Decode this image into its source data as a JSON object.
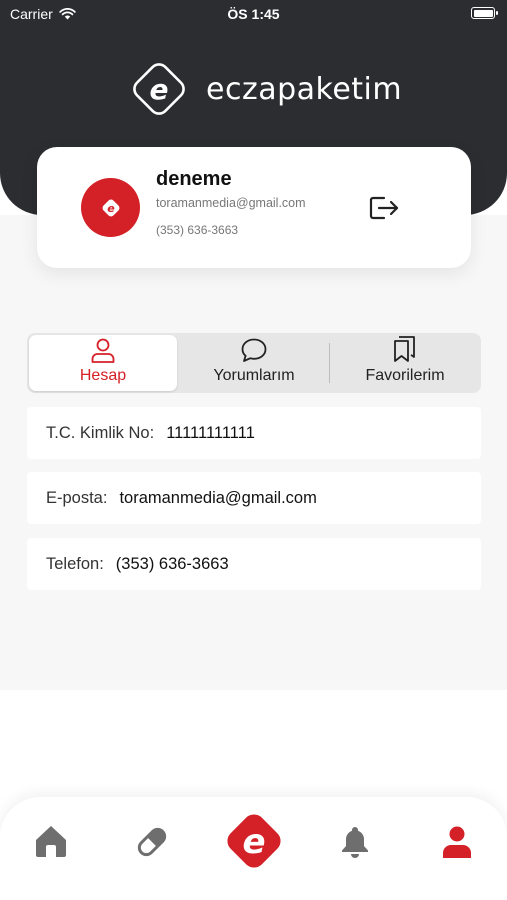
{
  "status_bar": {
    "carrier": "Carrier",
    "time": "ÖS 1:45"
  },
  "brand": {
    "name": "eczapaketim"
  },
  "profile": {
    "name": "deneme",
    "email": "toramanmedia@gmail.com",
    "phone": "(353) 636-3663"
  },
  "tabs": [
    {
      "label": "Hesap",
      "icon": "person-icon",
      "active": true
    },
    {
      "label": "Yorumlarım",
      "icon": "chat-bubble-icon",
      "active": false
    },
    {
      "label": "Favorilerim",
      "icon": "bookmarks-icon",
      "active": false
    }
  ],
  "fields": {
    "tc": {
      "label": "T.C. Kimlik No:",
      "value": "11111111111"
    },
    "email": {
      "label": "E-posta:",
      "value": "toramanmedia@gmail.com"
    },
    "phone": {
      "label": "Telefon:",
      "value": "(353) 636-3663"
    }
  },
  "bottom_nav": [
    {
      "icon": "home-icon",
      "active": false
    },
    {
      "icon": "pill-icon",
      "active": false
    },
    {
      "icon": "brand-e-icon",
      "active": false
    },
    {
      "icon": "bell-icon",
      "active": false
    },
    {
      "icon": "profile-icon",
      "active": true
    }
  ],
  "colors": {
    "accent": "#d42027",
    "header_bg": "#2b2d31",
    "page_bg": "#f7f7f7",
    "inactive_icon": "#6e6e6e"
  }
}
